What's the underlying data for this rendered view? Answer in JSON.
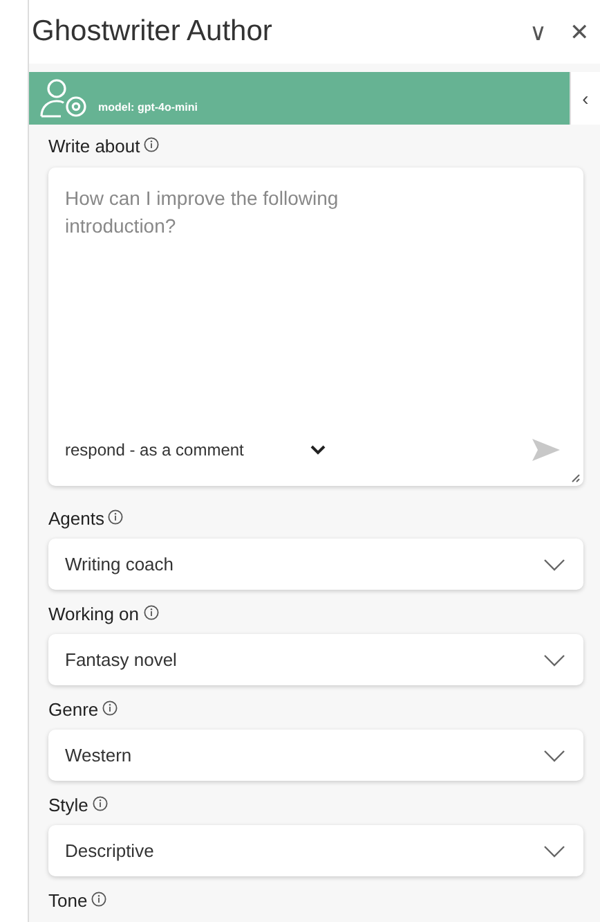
{
  "window": {
    "title": "Ghostwriter Author",
    "collapse_glyph": "∨",
    "close_glyph": "✕"
  },
  "banner": {
    "model": "model: gpt-4o-mini",
    "side_tab_glyph": "‹"
  },
  "prompt": {
    "label": "Write about",
    "placeholder": "How can I improve the following introduction?",
    "respond_mode": "respond - as a comment"
  },
  "fields": [
    {
      "label": "Agents",
      "value": "Writing coach"
    },
    {
      "label": "Working on",
      "value": "Fantasy novel"
    },
    {
      "label": "Genre",
      "value": "Western"
    },
    {
      "label": "Style",
      "value": "Descriptive"
    }
  ],
  "last_label": "Tone"
}
